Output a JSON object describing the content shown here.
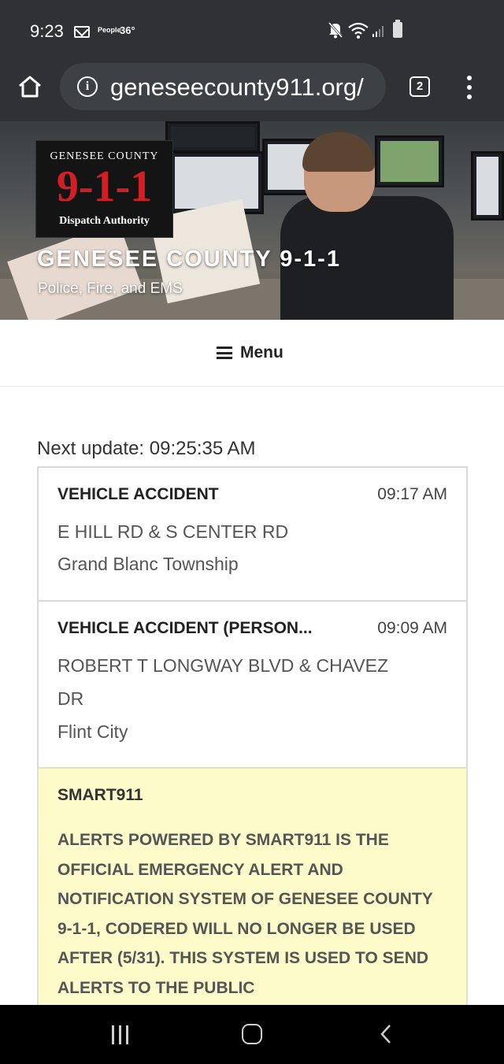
{
  "status_bar": {
    "time": "9:23",
    "people_label": "People",
    "temperature": "36°",
    "icons": [
      "mail-icon",
      "mute-icon",
      "wifi-icon",
      "signal-icon",
      "battery-icon"
    ]
  },
  "browser": {
    "url": "geneseecounty911.org/",
    "tab_count": "2",
    "icons": [
      "home-icon",
      "info-icon",
      "more-vert-icon"
    ]
  },
  "header": {
    "logo": {
      "top": "GENESEE COUNTY",
      "main": "9-1-1",
      "bottom": "Dispatch Authority"
    },
    "site_title": "GENESEE COUNTY 9-1-1",
    "tagline": "Police, Fire, and EMS"
  },
  "menu": {
    "label": "Menu"
  },
  "incidents": {
    "next_update": "Next update: 09:25:35 AM",
    "items": [
      {
        "title": "VEHICLE ACCIDENT",
        "time": "09:17 AM",
        "address": "E HILL RD & S CENTER RD",
        "area": "Grand Blanc Township"
      },
      {
        "title": "VEHICLE ACCIDENT (PERSON...",
        "time": "09:09 AM",
        "address_line1": "ROBERT T LONGWAY BLVD & CHAVEZ",
        "address_line2": "DR",
        "area": "Flint City"
      }
    ],
    "alert": {
      "title": "SMART911",
      "body": "ALERTS POWERED BY SMART911 IS THE OFFICIAL EMERGENCY ALERT AND NOTIFICATION SYSTEM OF GENESEE COUNTY 9-1-1, CODERED WILL NO LONGER BE USED AFTER (5/31). THIS SYSTEM IS USED TO SEND ALERTS TO THE PUBLIC"
    }
  },
  "colors": {
    "browser_chrome": "#2f3135",
    "alert_background": "#fdfbc9",
    "logo_red": "#d21f26"
  }
}
